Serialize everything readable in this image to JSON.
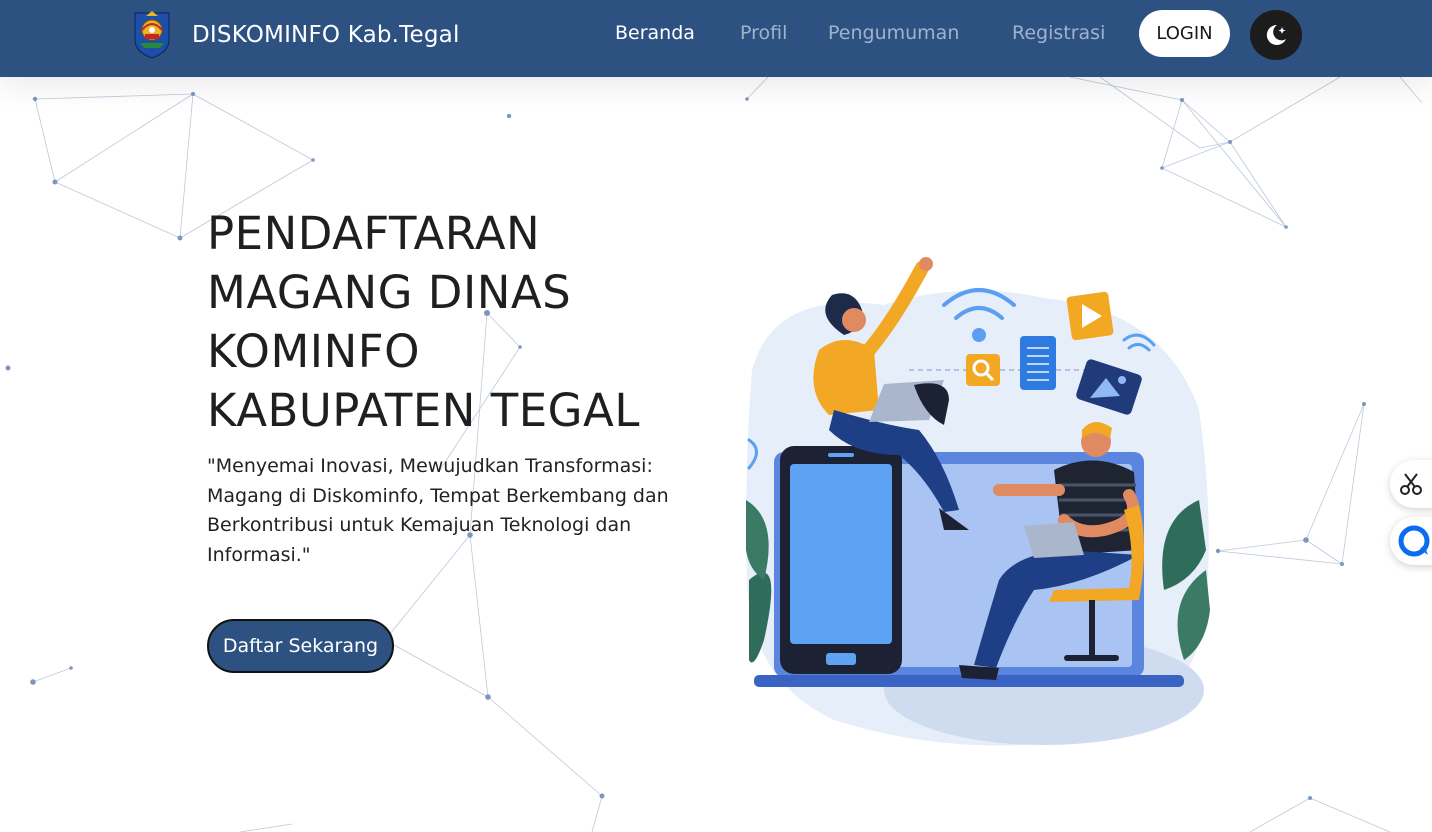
{
  "navbar": {
    "brand_name": "DISKOMINFO Kab.Tegal",
    "links": [
      {
        "label": "Beranda",
        "active": true
      },
      {
        "label": "Profil",
        "active": false
      },
      {
        "label": "Pengumuman",
        "active": false
      },
      {
        "label": "Registrasi",
        "active": false
      }
    ],
    "login_label": "LOGIN",
    "theme_toggle_icon": "moon-star-icon"
  },
  "hero": {
    "title_lines": [
      "PENDAFTARAN",
      "MAGANG DINAS",
      "KOMINFO",
      "KABUPATEN TEGAL"
    ],
    "quote_lines": [
      "\"Menyemai Inovasi, Mewujudkan Transformasi:",
      "Magang di Diskominfo, Tempat Berkembang dan",
      "Berkontribusi untuk Kemajuan Teknologi dan",
      "Informasi.\""
    ],
    "cta_label": "Daftar Sekarang",
    "illustration_icon": "people-working-with-devices-illustration"
  },
  "side_widgets": [
    {
      "icon": "scissors-icon"
    },
    {
      "icon": "chat-bubble-icon"
    }
  ],
  "colors": {
    "navbar_bg": "#2d5282",
    "nav_inactive": "#9fb3cc",
    "cta_bg": "#2d5282",
    "network_line": "#8fa6c8"
  }
}
